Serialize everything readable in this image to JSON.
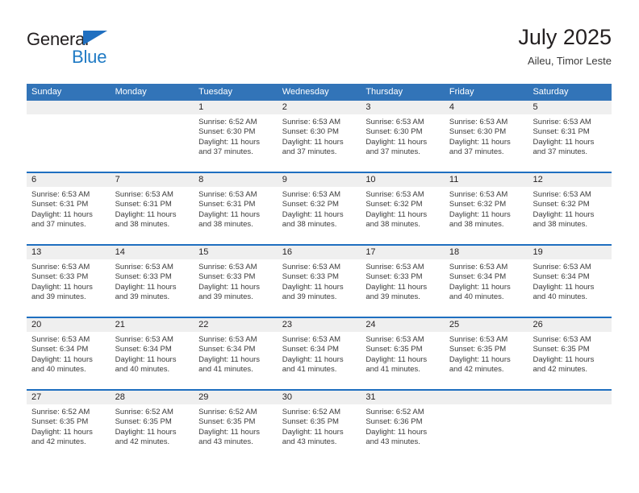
{
  "brand": {
    "line1": "General",
    "line2": "Blue",
    "triangle_icon": "triangle-logo-icon",
    "color_dark": "#231f20",
    "color_blue": "#1f7ac4"
  },
  "header": {
    "title": "July 2025",
    "subtitle": "Aileu, Timor Leste"
  },
  "theme": {
    "header_blue": "#3274b8",
    "divider_blue": "#1f6fc0",
    "band_gray": "#efefef"
  },
  "weekdays": [
    "Sunday",
    "Monday",
    "Tuesday",
    "Wednesday",
    "Thursday",
    "Friday",
    "Saturday"
  ],
  "weeks": [
    [
      {
        "day": "",
        "empty": true,
        "sunrise": "",
        "sunset": "",
        "daylight1": "",
        "daylight2": ""
      },
      {
        "day": "",
        "empty": true,
        "sunrise": "",
        "sunset": "",
        "daylight1": "",
        "daylight2": ""
      },
      {
        "day": "1",
        "sunrise": "Sunrise: 6:52 AM",
        "sunset": "Sunset: 6:30 PM",
        "daylight1": "Daylight: 11 hours",
        "daylight2": "and 37 minutes."
      },
      {
        "day": "2",
        "sunrise": "Sunrise: 6:53 AM",
        "sunset": "Sunset: 6:30 PM",
        "daylight1": "Daylight: 11 hours",
        "daylight2": "and 37 minutes."
      },
      {
        "day": "3",
        "sunrise": "Sunrise: 6:53 AM",
        "sunset": "Sunset: 6:30 PM",
        "daylight1": "Daylight: 11 hours",
        "daylight2": "and 37 minutes."
      },
      {
        "day": "4",
        "sunrise": "Sunrise: 6:53 AM",
        "sunset": "Sunset: 6:30 PM",
        "daylight1": "Daylight: 11 hours",
        "daylight2": "and 37 minutes."
      },
      {
        "day": "5",
        "sunrise": "Sunrise: 6:53 AM",
        "sunset": "Sunset: 6:31 PM",
        "daylight1": "Daylight: 11 hours",
        "daylight2": "and 37 minutes."
      }
    ],
    [
      {
        "day": "6",
        "sunrise": "Sunrise: 6:53 AM",
        "sunset": "Sunset: 6:31 PM",
        "daylight1": "Daylight: 11 hours",
        "daylight2": "and 37 minutes."
      },
      {
        "day": "7",
        "sunrise": "Sunrise: 6:53 AM",
        "sunset": "Sunset: 6:31 PM",
        "daylight1": "Daylight: 11 hours",
        "daylight2": "and 38 minutes."
      },
      {
        "day": "8",
        "sunrise": "Sunrise: 6:53 AM",
        "sunset": "Sunset: 6:31 PM",
        "daylight1": "Daylight: 11 hours",
        "daylight2": "and 38 minutes."
      },
      {
        "day": "9",
        "sunrise": "Sunrise: 6:53 AM",
        "sunset": "Sunset: 6:32 PM",
        "daylight1": "Daylight: 11 hours",
        "daylight2": "and 38 minutes."
      },
      {
        "day": "10",
        "sunrise": "Sunrise: 6:53 AM",
        "sunset": "Sunset: 6:32 PM",
        "daylight1": "Daylight: 11 hours",
        "daylight2": "and 38 minutes."
      },
      {
        "day": "11",
        "sunrise": "Sunrise: 6:53 AM",
        "sunset": "Sunset: 6:32 PM",
        "daylight1": "Daylight: 11 hours",
        "daylight2": "and 38 minutes."
      },
      {
        "day": "12",
        "sunrise": "Sunrise: 6:53 AM",
        "sunset": "Sunset: 6:32 PM",
        "daylight1": "Daylight: 11 hours",
        "daylight2": "and 38 minutes."
      }
    ],
    [
      {
        "day": "13",
        "sunrise": "Sunrise: 6:53 AM",
        "sunset": "Sunset: 6:33 PM",
        "daylight1": "Daylight: 11 hours",
        "daylight2": "and 39 minutes."
      },
      {
        "day": "14",
        "sunrise": "Sunrise: 6:53 AM",
        "sunset": "Sunset: 6:33 PM",
        "daylight1": "Daylight: 11 hours",
        "daylight2": "and 39 minutes."
      },
      {
        "day": "15",
        "sunrise": "Sunrise: 6:53 AM",
        "sunset": "Sunset: 6:33 PM",
        "daylight1": "Daylight: 11 hours",
        "daylight2": "and 39 minutes."
      },
      {
        "day": "16",
        "sunrise": "Sunrise: 6:53 AM",
        "sunset": "Sunset: 6:33 PM",
        "daylight1": "Daylight: 11 hours",
        "daylight2": "and 39 minutes."
      },
      {
        "day": "17",
        "sunrise": "Sunrise: 6:53 AM",
        "sunset": "Sunset: 6:33 PM",
        "daylight1": "Daylight: 11 hours",
        "daylight2": "and 39 minutes."
      },
      {
        "day": "18",
        "sunrise": "Sunrise: 6:53 AM",
        "sunset": "Sunset: 6:34 PM",
        "daylight1": "Daylight: 11 hours",
        "daylight2": "and 40 minutes."
      },
      {
        "day": "19",
        "sunrise": "Sunrise: 6:53 AM",
        "sunset": "Sunset: 6:34 PM",
        "daylight1": "Daylight: 11 hours",
        "daylight2": "and 40 minutes."
      }
    ],
    [
      {
        "day": "20",
        "sunrise": "Sunrise: 6:53 AM",
        "sunset": "Sunset: 6:34 PM",
        "daylight1": "Daylight: 11 hours",
        "daylight2": "and 40 minutes."
      },
      {
        "day": "21",
        "sunrise": "Sunrise: 6:53 AM",
        "sunset": "Sunset: 6:34 PM",
        "daylight1": "Daylight: 11 hours",
        "daylight2": "and 40 minutes."
      },
      {
        "day": "22",
        "sunrise": "Sunrise: 6:53 AM",
        "sunset": "Sunset: 6:34 PM",
        "daylight1": "Daylight: 11 hours",
        "daylight2": "and 41 minutes."
      },
      {
        "day": "23",
        "sunrise": "Sunrise: 6:53 AM",
        "sunset": "Sunset: 6:34 PM",
        "daylight1": "Daylight: 11 hours",
        "daylight2": "and 41 minutes."
      },
      {
        "day": "24",
        "sunrise": "Sunrise: 6:53 AM",
        "sunset": "Sunset: 6:35 PM",
        "daylight1": "Daylight: 11 hours",
        "daylight2": "and 41 minutes."
      },
      {
        "day": "25",
        "sunrise": "Sunrise: 6:53 AM",
        "sunset": "Sunset: 6:35 PM",
        "daylight1": "Daylight: 11 hours",
        "daylight2": "and 42 minutes."
      },
      {
        "day": "26",
        "sunrise": "Sunrise: 6:53 AM",
        "sunset": "Sunset: 6:35 PM",
        "daylight1": "Daylight: 11 hours",
        "daylight2": "and 42 minutes."
      }
    ],
    [
      {
        "day": "27",
        "sunrise": "Sunrise: 6:52 AM",
        "sunset": "Sunset: 6:35 PM",
        "daylight1": "Daylight: 11 hours",
        "daylight2": "and 42 minutes."
      },
      {
        "day": "28",
        "sunrise": "Sunrise: 6:52 AM",
        "sunset": "Sunset: 6:35 PM",
        "daylight1": "Daylight: 11 hours",
        "daylight2": "and 42 minutes."
      },
      {
        "day": "29",
        "sunrise": "Sunrise: 6:52 AM",
        "sunset": "Sunset: 6:35 PM",
        "daylight1": "Daylight: 11 hours",
        "daylight2": "and 43 minutes."
      },
      {
        "day": "30",
        "sunrise": "Sunrise: 6:52 AM",
        "sunset": "Sunset: 6:35 PM",
        "daylight1": "Daylight: 11 hours",
        "daylight2": "and 43 minutes."
      },
      {
        "day": "31",
        "sunrise": "Sunrise: 6:52 AM",
        "sunset": "Sunset: 6:36 PM",
        "daylight1": "Daylight: 11 hours",
        "daylight2": "and 43 minutes."
      },
      {
        "day": "",
        "empty": true,
        "sunrise": "",
        "sunset": "",
        "daylight1": "",
        "daylight2": ""
      },
      {
        "day": "",
        "empty": true,
        "sunrise": "",
        "sunset": "",
        "daylight1": "",
        "daylight2": ""
      }
    ]
  ]
}
